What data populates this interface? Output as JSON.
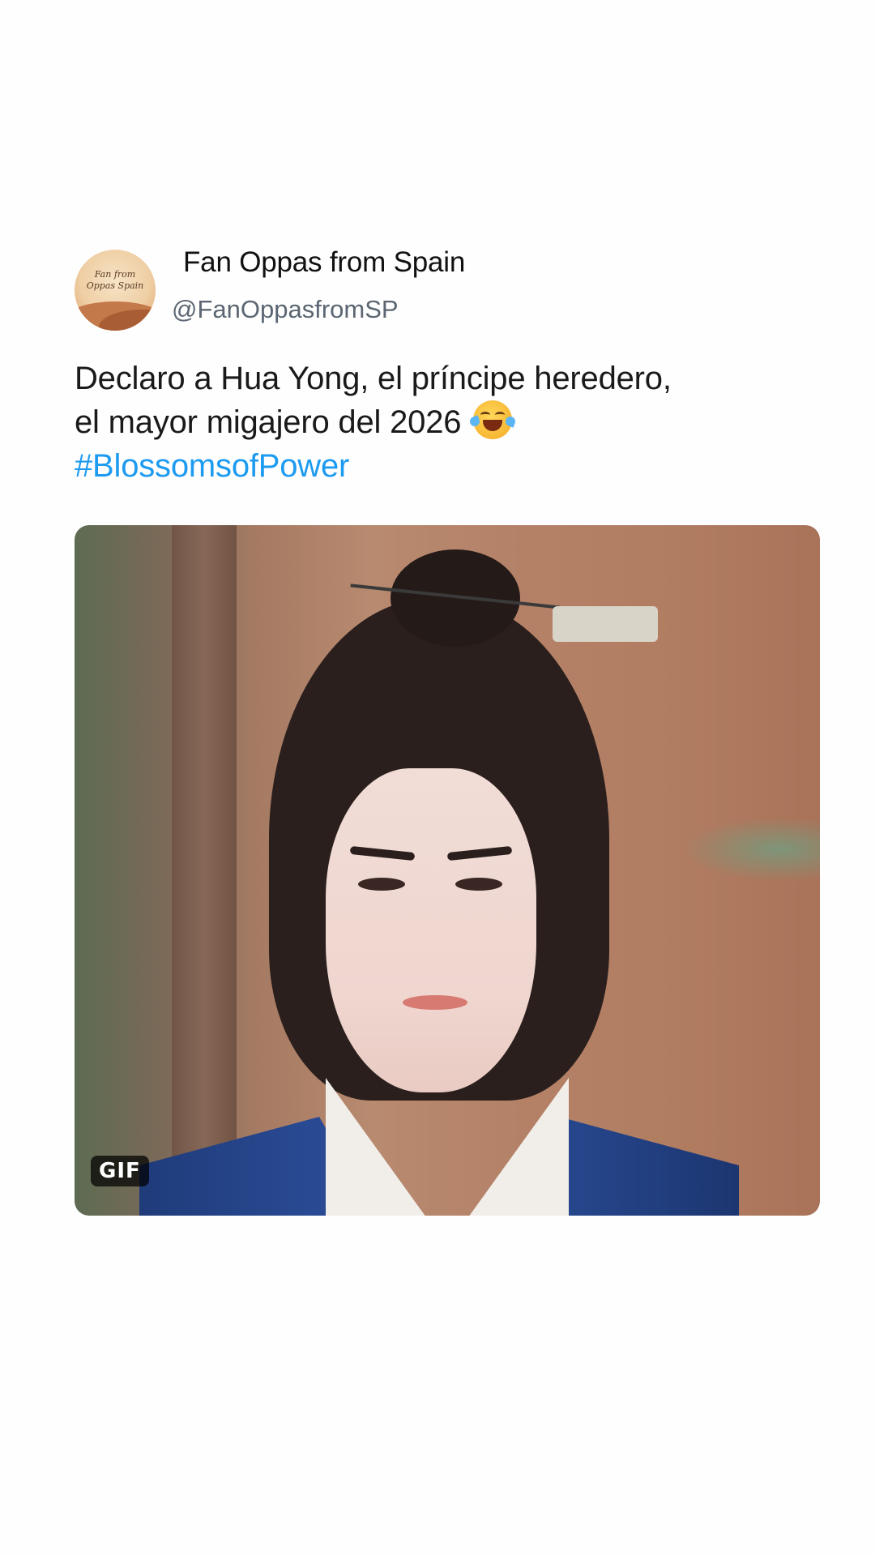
{
  "tweet": {
    "display_name": "Fan Oppas from Spain",
    "handle": "@FanOppasfromSP",
    "avatar": {
      "logo_lines": [
        "Fan",
        "from",
        "Oppas",
        "Spain"
      ],
      "icon": "heart-hand-icon"
    },
    "text_lines": [
      "Declaro a Hua Yong, el príncipe heredero,",
      "el mayor migajero del 2026"
    ],
    "emoji": "face-with-tears-of-joy-emoji",
    "hashtag": "#BlossomsofPower"
  },
  "media": {
    "badge": "GIF"
  },
  "colors": {
    "hashtag": "#1d9bf0",
    "handle": "#5b6672",
    "text": "#1a1a1a"
  }
}
